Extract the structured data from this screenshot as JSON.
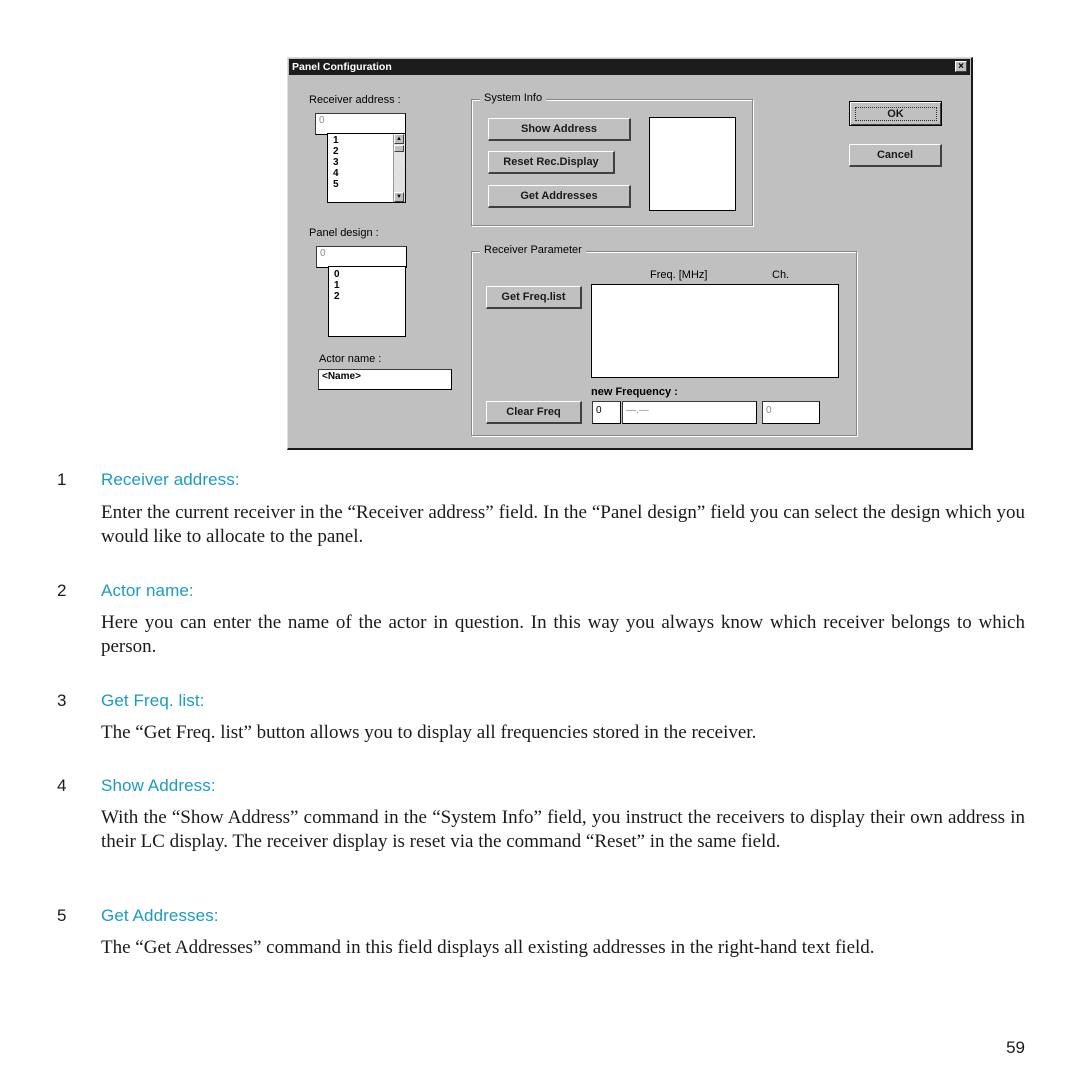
{
  "dialog": {
    "title": "Panel Configuration",
    "close_glyph": "×",
    "receiver_address": {
      "label": "Receiver address :",
      "value": "0",
      "options": [
        "1",
        "2",
        "3",
        "4",
        "5"
      ]
    },
    "panel_design": {
      "label": "Panel design :",
      "value": "0",
      "options": [
        "0",
        "1",
        "2"
      ]
    },
    "actor_name": {
      "label": "Actor name :",
      "value": "<Name>"
    },
    "system_info": {
      "title": "System Info",
      "show_address": "Show Address",
      "reset_display": "Reset Rec.Display",
      "get_addresses": "Get Addresses"
    },
    "ok": "OK",
    "cancel": "Cancel",
    "receiver_parameter": {
      "title": "Receiver Parameter",
      "freq_header": "Freq. [MHz]",
      "ch_header": "Ch.",
      "get_freq_list": "Get Freq.list",
      "new_frequency_label": "new Frequency :",
      "clear_freq": "Clear Freq",
      "new_freq_index": "0",
      "new_freq_value": "—.—",
      "new_freq_channel": "0"
    }
  },
  "sections": [
    {
      "number": "1",
      "title": "Receiver address:",
      "body": "Enter the current receiver in the “Receiver address” field. In the “Panel design” field you can select the design which you would like to allocate to the panel."
    },
    {
      "number": "2",
      "title": "Actor name:",
      "body": "Here you can enter the name of the actor in question. In this way you always know which receiver belongs to which person."
    },
    {
      "number": "3",
      "title": "Get Freq. list:",
      "body": "The “Get Freq. list” button allows you to display all frequencies stored in the receiver."
    },
    {
      "number": "4",
      "title": "Show Address:",
      "body": "With the “Show Address” command in the “System Info” field, you instruct the receivers to display their own address in their LC display. The receiver display is reset via the command “Reset” in the same field."
    },
    {
      "number": "5",
      "title": "Get Addresses:",
      "body": "The “Get Addresses” command in this field displays all existing addresses in the right-hand text field."
    }
  ],
  "page_number": "59"
}
